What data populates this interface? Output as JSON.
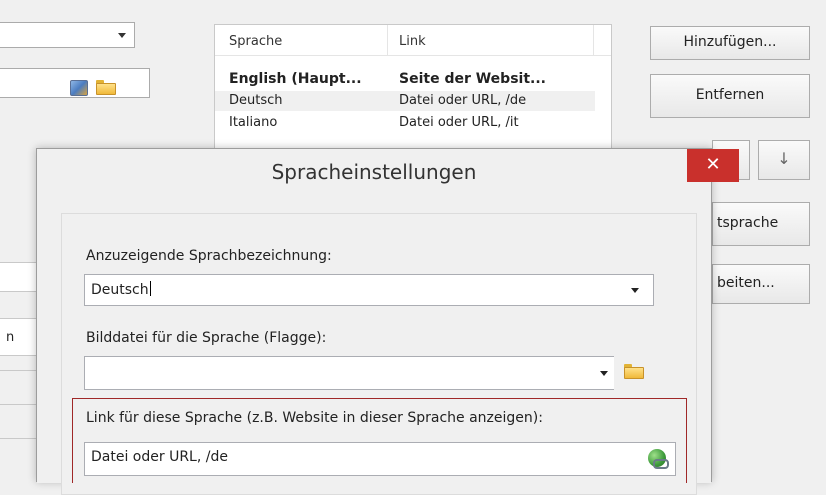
{
  "list": {
    "headers": [
      "Sprache",
      "Link"
    ],
    "rows": [
      {
        "lang": "English (Haupt...",
        "link": "Seite der Websit...",
        "bold": true
      },
      {
        "lang": "Deutsch",
        "link": "Datei oder URL, /de"
      },
      {
        "lang": "Italiano",
        "link": "Datei oder URL, /it"
      }
    ]
  },
  "buttons": {
    "add": "Hinzufügen...",
    "remove": "Entfernen",
    "down_glyph": "↓",
    "main_language_partial": "tsprache",
    "edit_partial": "beiten..."
  },
  "background": {
    "partial_label": "n"
  },
  "dialog": {
    "title": "Spracheinstellungen",
    "close_glyph": "✕",
    "name_label": "Anzuzeigende Sprachbezeichnung:",
    "name_value": "Deutsch",
    "image_label": "Bilddatei für die Sprache (Flagge):",
    "image_value": "",
    "link_label": "Link für diese Sprache (z.B. Website in dieser Sprache anzeigen):",
    "link_value": "Datei oder URL, /de"
  },
  "colors": {
    "close_red": "#c9302c",
    "highlight_border": "#a02828"
  }
}
